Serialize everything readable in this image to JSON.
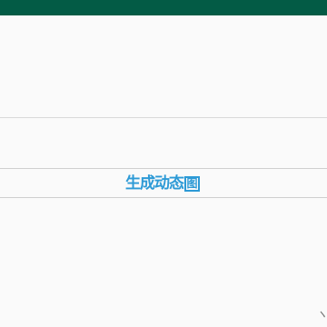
{
  "status_bar": {
    "color": "#035b45"
  },
  "action_bar": {
    "generate_label": "生成动态",
    "generate_box_char": "图",
    "accent": "#2d9ad6"
  },
  "corner_mark": {
    "icon": "pencil-mark-icon"
  }
}
